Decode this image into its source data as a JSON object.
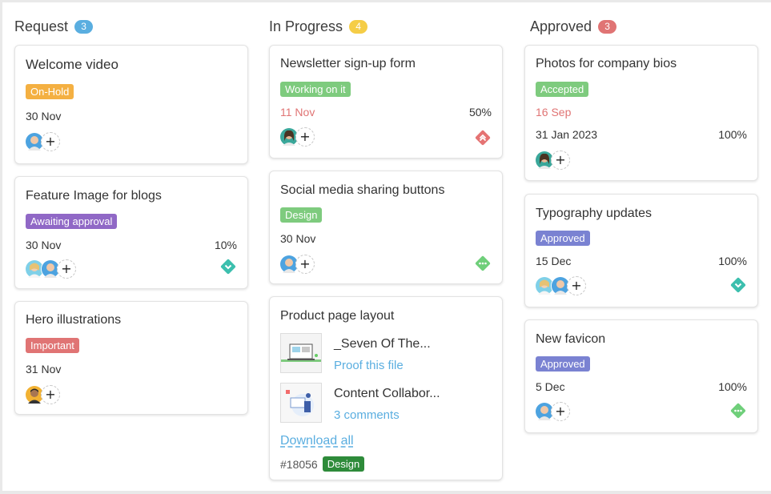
{
  "columns": [
    {
      "title": "Request",
      "count": "3",
      "count_color": "#5aaee0",
      "cards": [
        {
          "title": "Welcome video",
          "tag": "On-Hold",
          "tag_color": "#f4b042",
          "date": "30 Nov",
          "avatars": [
            "blue-man"
          ]
        },
        {
          "title": "Feature Image for blogs",
          "tag": "Awaiting approval",
          "tag_color": "#9068c6",
          "date": "30 Nov",
          "percent": "10%",
          "avatars": [
            "blonde-woman",
            "blue-man"
          ],
          "priority": "chevron-down-icon"
        },
        {
          "title": "Hero illustrations",
          "tag": "Important",
          "tag_color": "#e07474",
          "date": "31 Nov",
          "avatars": [
            "dark-man"
          ]
        }
      ]
    },
    {
      "title": "In Progress",
      "count": "4",
      "count_color": "#f5cd47",
      "cards": [
        {
          "title": "Newsletter sign-up form",
          "tag": "Working on it",
          "tag_color": "#7ecb7e",
          "date": "11 Nov",
          "date_color": "#e07474",
          "percent": "50%",
          "avatars": [
            "teal-woman"
          ],
          "priority": "double-chevron-up-icon"
        },
        {
          "title": "Social media sharing buttons",
          "tag": "Design",
          "tag_color": "#7ecb7e",
          "date": "30 Nov",
          "avatars": [
            "blue-man"
          ],
          "priority": "dots-icon"
        },
        {
          "title": "Product page layout",
          "files": [
            {
              "name": "_Seven Of The...",
              "link": "Proof this file",
              "thumb": "laptop-thumb"
            },
            {
              "name": "Content Collabor...",
              "link": "3 comments",
              "thumb": "illustration-thumb"
            }
          ],
          "download": "Download all",
          "ticket": "#18056",
          "ticket_tag": "Design",
          "ticket_tag_color": "#2e8b3a"
        }
      ]
    },
    {
      "title": "Approved",
      "count": "3",
      "count_color": "#e07474",
      "cards": [
        {
          "title": "Photos for company bios",
          "tag": "Accepted",
          "tag_color": "#7ecb7e",
          "date": "16 Sep",
          "date_color": "#e07474",
          "date2": "31 Jan 2023",
          "percent": "100%",
          "avatars": [
            "teal-woman"
          ]
        },
        {
          "title": "Typography updates",
          "tag": "Approved",
          "tag_color": "#7a82d2",
          "date": "15 Dec",
          "percent": "100%",
          "avatars": [
            "blonde-woman",
            "blue-man"
          ],
          "priority": "chevron-down-icon"
        },
        {
          "title": "New favicon",
          "tag": "Approved",
          "tag_color": "#7a82d2",
          "date": "5 Dec",
          "percent": "100%",
          "avatars": [
            "blue-man"
          ],
          "priority": "dots-icon"
        }
      ]
    }
  ],
  "add_symbol": "+",
  "colors": {
    "teal_priority": "#3cbfae",
    "red_priority": "#e57373",
    "green_priority": "#6fcf7a"
  }
}
